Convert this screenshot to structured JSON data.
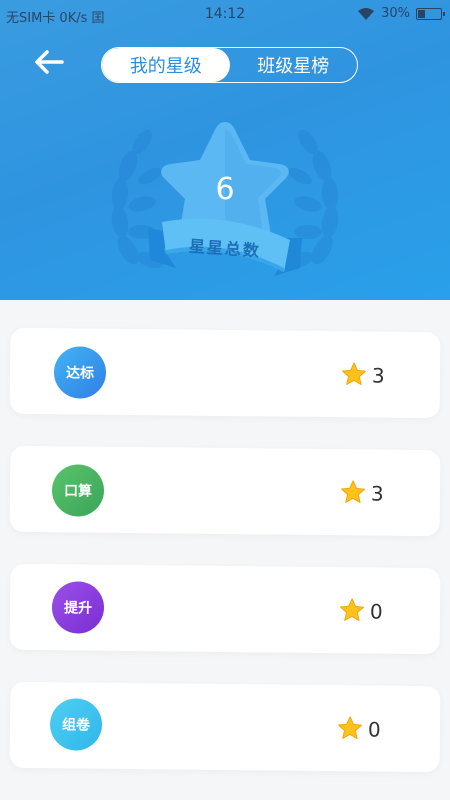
{
  "status_bar": {
    "carrier": "无SIM卡 0K/s 囯",
    "time": "14:12",
    "battery": "30%",
    "battery_level": 0.3
  },
  "nav": {
    "back_icon": "back-arrow-icon",
    "tabs": [
      {
        "label": "我的星级",
        "active": true
      },
      {
        "label": "班级星榜",
        "active": false
      }
    ]
  },
  "summary": {
    "total_stars": "6",
    "label": "星星总数"
  },
  "colors": {
    "header": "#2f94e0",
    "accent": "#2b8fe0",
    "star": "#ffc21c"
  },
  "categories": [
    {
      "name": "达标",
      "stars": "3",
      "color_from": "#42b4f4",
      "color_to": "#2f7fe6"
    },
    {
      "name": "口算",
      "stars": "3",
      "color_from": "#5bc36a",
      "color_to": "#3aa55a"
    },
    {
      "name": "提升",
      "stars": "0",
      "color_from": "#9b4fe8",
      "color_to": "#7a2ed4"
    },
    {
      "name": "组卷",
      "stars": "0",
      "color_from": "#4fd0f2",
      "color_to": "#2fb6ea"
    }
  ]
}
